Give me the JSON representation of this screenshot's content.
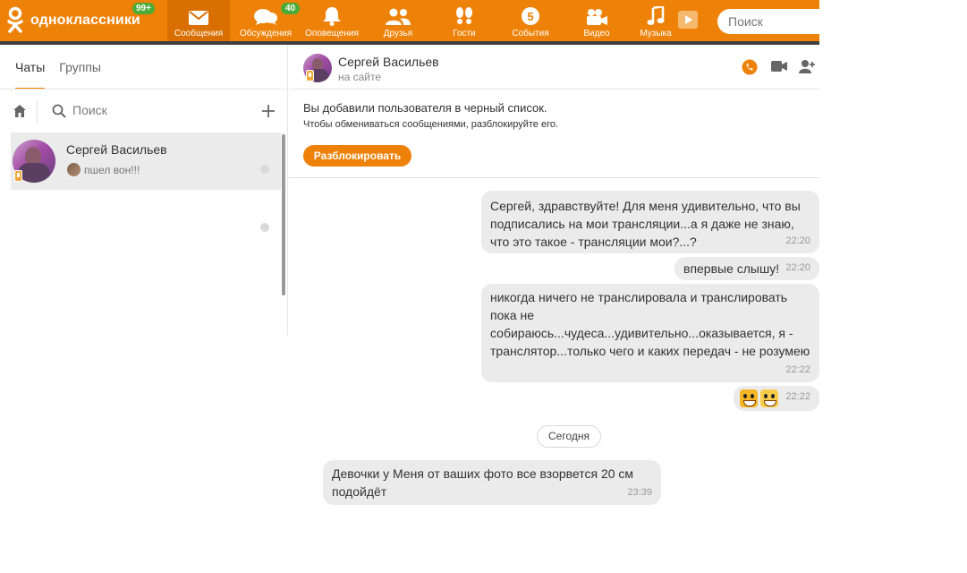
{
  "topbar": {
    "logo_text": "одноклассники",
    "logo_badge": "99+",
    "nav": [
      {
        "label": "Сообщения",
        "icon": "envelope-icon",
        "active": true
      },
      {
        "label": "Обсуждения",
        "icon": "speech-bubbles-icon",
        "badge": "40"
      },
      {
        "label": "Оповещения",
        "icon": "bell-icon"
      },
      {
        "label": "Друзья",
        "icon": "friends-icon"
      },
      {
        "label": "Гости",
        "icon": "footprints-icon"
      },
      {
        "label": "События",
        "icon": "events-icon"
      },
      {
        "label": "Видео",
        "icon": "video-camera-icon"
      },
      {
        "label": "Музыка",
        "icon": "music-note-icon"
      }
    ],
    "search_placeholder": "Поиск",
    "colors": {
      "accent": "#ee8208",
      "badge": "#4bab36"
    }
  },
  "left": {
    "tabs": [
      "Чаты",
      "Группы"
    ],
    "search_placeholder": "Поиск",
    "chats": [
      {
        "name": "Сергей Васильев",
        "preview": "пшел вон!!!"
      }
    ]
  },
  "chat": {
    "name": "Сергей Васильев",
    "status": "на сайте",
    "notice_title": "Вы добавили пользователя в черный список.",
    "notice_sub": "Чтобы обмениваться сообщениями, разблокируйте его.",
    "unblock_label": "Разблокировать",
    "messages": [
      {
        "text": "Сергей, здравствуйте! Для меня удивительно, что вы\nподписались на мои трансляции...а я даже не знаю,\nчто это такое - трансляции мои?...?",
        "time": "22:20"
      },
      {
        "text": "впервые слышу!",
        "time": "22:20"
      },
      {
        "text": "никогда ничего не транслировала и транслировать\nпока не\nсобираюсь...чудеса...удивительно...оказывается, я -\nтранслятор...только чего и каких передач - не розумею",
        "time": "22:22"
      },
      {
        "text": "",
        "time": "22:22"
      },
      {
        "text": "Девочки у Меня от ваших  фото все взорвется 20 см\nподойдёт",
        "time": "23:39"
      }
    ],
    "day_separator": "Сегодня"
  }
}
